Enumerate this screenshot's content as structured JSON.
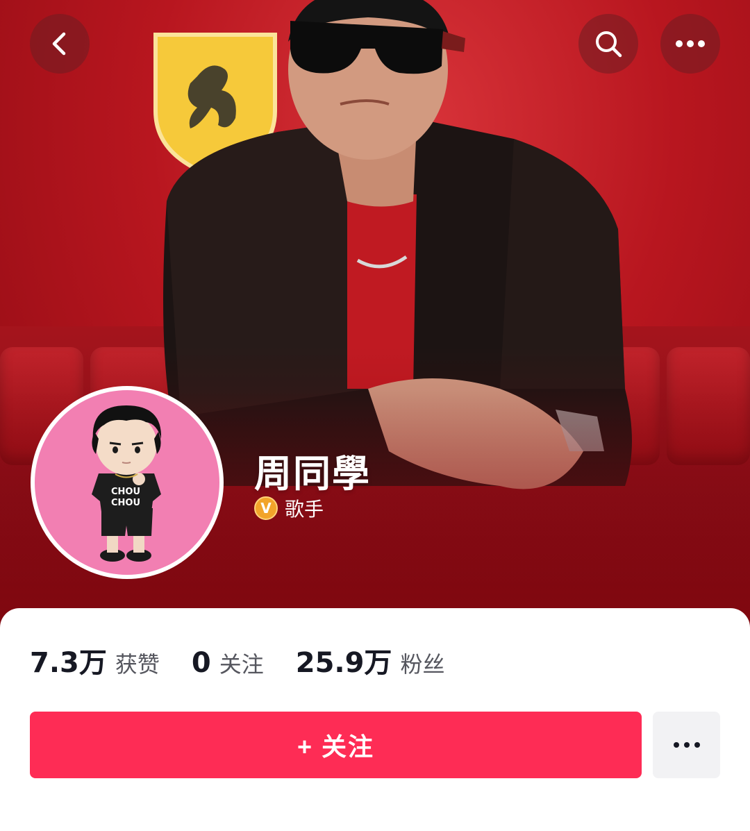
{
  "profile": {
    "name": "周同學",
    "tag": "歌手",
    "verified_badge": "V"
  },
  "stats": [
    {
      "value": "7.3万",
      "label": "获赞"
    },
    {
      "value": "0",
      "label": "关注"
    },
    {
      "value": "25.9万",
      "label": "粉丝"
    }
  ],
  "actions": {
    "follow_label": "+ 关注"
  },
  "icons": {
    "back": "back-arrow-icon",
    "search": "search-icon",
    "more": "more-dots-icon",
    "more_sheet": "more-dots-icon"
  },
  "colors": {
    "follow_button": "#fe2c55",
    "cover_red": "#b8161f",
    "avatar_bg": "#f27fb2",
    "badge_gold": "#f2a42a"
  }
}
